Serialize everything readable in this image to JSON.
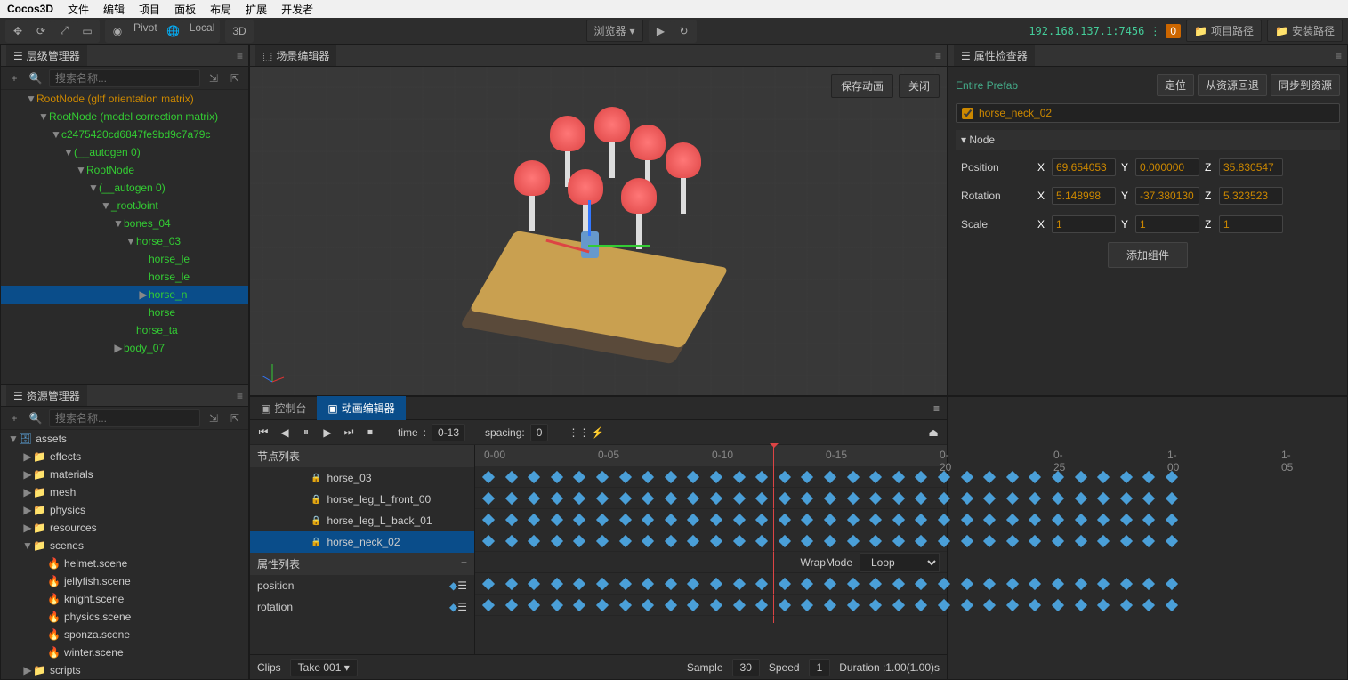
{
  "app_title": "Cocos3D",
  "menu": [
    "文件",
    "编辑",
    "项目",
    "面板",
    "布局",
    "扩展",
    "开发者"
  ],
  "toolbar": {
    "pivot": "Pivot",
    "local": "Local",
    "mode3d": "3D",
    "preview": "浏览器",
    "ip": "192.168.137.1:7456",
    "badge": "0",
    "project_path": "项目路径",
    "install_path": "安装路径"
  },
  "hierarchy": {
    "title": "层级管理器",
    "search_ph": "搜索名称...",
    "tree": [
      {
        "indent": 2,
        "name": "RootNode (gltf orientation matrix)",
        "orange": true,
        "arrow": "▼"
      },
      {
        "indent": 3,
        "name": "RootNode (model correction matrix)",
        "arrow": "▼"
      },
      {
        "indent": 4,
        "name": "c2475420cd6847fe9bd9c7a79c",
        "arrow": "▼"
      },
      {
        "indent": 5,
        "name": "(__autogen 0)",
        "arrow": "▼"
      },
      {
        "indent": 6,
        "name": "RootNode",
        "arrow": "▼"
      },
      {
        "indent": 7,
        "name": "(__autogen 0)",
        "arrow": "▼"
      },
      {
        "indent": 8,
        "name": "_rootJoint",
        "arrow": "▼"
      },
      {
        "indent": 9,
        "name": "bones_04",
        "arrow": "▼"
      },
      {
        "indent": 10,
        "name": "horse_03",
        "arrow": "▼"
      },
      {
        "indent": 11,
        "name": "horse_le",
        "arrow": ""
      },
      {
        "indent": 11,
        "name": "horse_le",
        "arrow": ""
      },
      {
        "indent": 11,
        "name": "horse_n",
        "arrow": "▶",
        "selected": true
      },
      {
        "indent": 11,
        "name": "horse",
        "arrow": ""
      },
      {
        "indent": 10,
        "name": "horse_ta",
        "arrow": ""
      },
      {
        "indent": 9,
        "name": "body_07",
        "arrow": "▶"
      }
    ]
  },
  "assets": {
    "title": "资源管理器",
    "search_ph": "搜索名称...",
    "tree": [
      {
        "indent": 0,
        "name": "assets",
        "icon": "db",
        "arrow": "▼"
      },
      {
        "indent": 1,
        "name": "effects",
        "icon": "folder",
        "arrow": "▶"
      },
      {
        "indent": 1,
        "name": "materials",
        "icon": "folder",
        "arrow": "▶"
      },
      {
        "indent": 1,
        "name": "mesh",
        "icon": "folder",
        "arrow": "▶"
      },
      {
        "indent": 1,
        "name": "physics",
        "icon": "folder",
        "arrow": "▶"
      },
      {
        "indent": 1,
        "name": "resources",
        "icon": "folder",
        "arrow": "▶"
      },
      {
        "indent": 1,
        "name": "scenes",
        "icon": "folder",
        "arrow": "▼"
      },
      {
        "indent": 2,
        "name": "helmet.scene",
        "icon": "fire"
      },
      {
        "indent": 2,
        "name": "jellyfish.scene",
        "icon": "fire"
      },
      {
        "indent": 2,
        "name": "knight.scene",
        "icon": "fire"
      },
      {
        "indent": 2,
        "name": "physics.scene",
        "icon": "fire"
      },
      {
        "indent": 2,
        "name": "sponza.scene",
        "icon": "fire"
      },
      {
        "indent": 2,
        "name": "winter.scene",
        "icon": "fire"
      },
      {
        "indent": 1,
        "name": "scripts",
        "icon": "folder",
        "arrow": "▶"
      }
    ]
  },
  "scene": {
    "title": "场景编辑器",
    "save_anim": "保存动画",
    "close": "关闭"
  },
  "inspector": {
    "title": "属性检查器",
    "prefab": "Entire Prefab",
    "btns": {
      "locate": "定位",
      "revert": "从资源回退",
      "sync": "同步到资源"
    },
    "node_name": "horse_neck_02",
    "section": "Node",
    "position": {
      "label": "Position",
      "x": "69.654053",
      "y": "0.000000",
      "z": "35.830547"
    },
    "rotation": {
      "label": "Rotation",
      "x": "5.148998",
      "y": "-37.380130",
      "z": "5.323523"
    },
    "scale": {
      "label": "Scale",
      "x": "1",
      "y": "1",
      "z": "1"
    },
    "add_component": "添加组件"
  },
  "console_tab": "控制台",
  "anim": {
    "title": "动画编辑器",
    "time_label": "time",
    "time_val": "0-13",
    "spacing_label": "spacing:",
    "spacing_val": "0",
    "node_list": "节点列表",
    "nodes": [
      {
        "name": "horse_03"
      },
      {
        "name": "horse_leg_L_front_00"
      },
      {
        "name": "horse_leg_L_back_01"
      },
      {
        "name": "horse_neck_02",
        "selected": true
      }
    ],
    "prop_list": "属性列表",
    "props": [
      "position",
      "rotation"
    ],
    "ruler": [
      "0-00",
      "0-05",
      "0-10",
      "0-15",
      "0-20",
      "0-25",
      "1-00",
      "1-05"
    ],
    "wrapmode_label": "WrapMode",
    "wrapmode": "Loop",
    "clips_label": "Clips",
    "clip": "Take 001",
    "sample_label": "Sample",
    "sample": "30",
    "speed_label": "Speed",
    "speed": "1",
    "duration": "Duration :1.00(1.00)s"
  }
}
